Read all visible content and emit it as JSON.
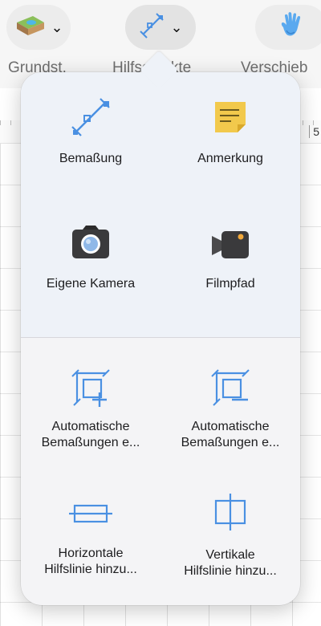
{
  "toolbar": {
    "tools": [
      {
        "label": "Grundst.",
        "icon": "terrain-icon"
      },
      {
        "label": "Hilfsobjekte",
        "icon": "dimension-tool-icon"
      },
      {
        "label": "Verschieb",
        "icon": "hand-icon"
      }
    ]
  },
  "ruler": {
    "number": "5"
  },
  "popover": {
    "items": [
      {
        "label": "Bemaßung",
        "icon": "dimension-icon"
      },
      {
        "label": "Anmerkung",
        "icon": "note-icon"
      },
      {
        "label": "Eigene Kamera",
        "icon": "camera-icon"
      },
      {
        "label": "Filmpfad",
        "icon": "video-camera-icon"
      },
      {
        "label_line1": "Automatische",
        "label_line2": "Bemaßungen e...",
        "icon": "auto-dimensions-add-icon"
      },
      {
        "label_line1": "Automatische",
        "label_line2": "Bemaßungen e...",
        "icon": "auto-dimensions-remove-icon"
      },
      {
        "label_line1": "Horizontale",
        "label_line2": "Hilfslinie hinzu...",
        "icon": "horizontal-guide-icon"
      },
      {
        "label_line1": "Vertikale",
        "label_line2": "Hilfslinie hinzu...",
        "icon": "vertical-guide-icon"
      }
    ]
  },
  "colors": {
    "accent": "#4a90e2",
    "note": "#f2c94c",
    "popover_bg": "#f4f4f6"
  }
}
